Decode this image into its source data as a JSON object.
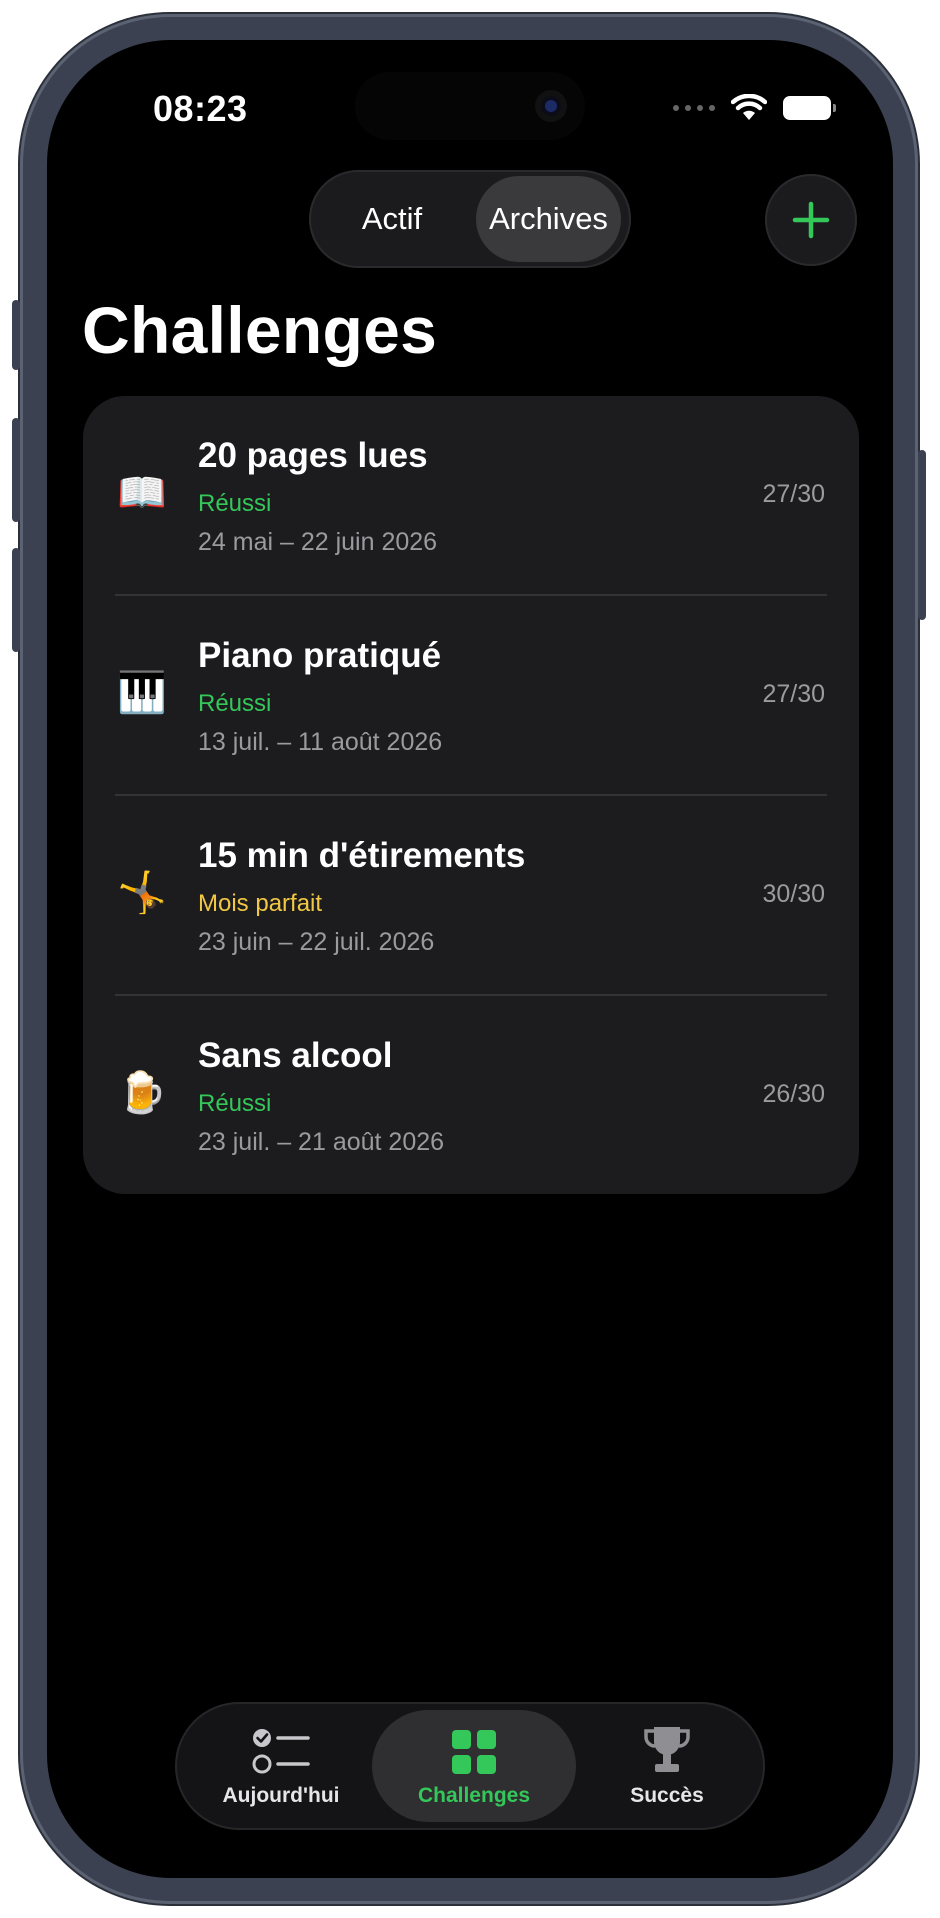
{
  "status_bar": {
    "time": "08:23"
  },
  "segmented": {
    "options": [
      "Actif",
      "Archives"
    ],
    "selected": "Archives"
  },
  "page_title": "Challenges",
  "challenges": [
    {
      "emoji": "📖",
      "name": "20 pages lues",
      "status": "Réussi",
      "status_color": "#34c759",
      "dates": "24 mai – 22 juin 2026",
      "progress": "27/30"
    },
    {
      "emoji": "🎹",
      "name": "Piano pratiqué",
      "status": "Réussi",
      "status_color": "#34c759",
      "dates": "13 juil. – 11 août 2026",
      "progress": "27/30"
    },
    {
      "emoji": "🤸",
      "name": "15 min d'étirements",
      "status": "Mois parfait",
      "status_color": "#f2c744",
      "dates": "23 juin – 22 juil. 2026",
      "progress": "30/30"
    },
    {
      "emoji": "🍺",
      "name": "Sans alcool",
      "status": "Réussi",
      "status_color": "#34c759",
      "dates": "23 juil. – 21 août 2026",
      "progress": "26/30"
    }
  ],
  "tabbar": {
    "items": [
      {
        "label": "Aujourd'hui",
        "icon": "checklist-icon"
      },
      {
        "label": "Challenges",
        "icon": "grid-icon"
      },
      {
        "label": "Succès",
        "icon": "trophy-icon"
      }
    ],
    "active": "Challenges"
  },
  "colors": {
    "accent": "#34c759",
    "gold": "#f2c744",
    "card": "#1c1c1e"
  }
}
